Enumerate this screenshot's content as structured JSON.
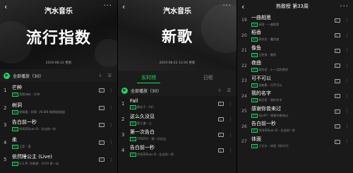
{
  "panel1": {
    "brand": "汽水音乐",
    "big_title": "流行指数",
    "date": "2019-08-22 更新",
    "play_all": "全部播放（30）",
    "songs": [
      {
        "num": "1",
        "title": "芒种",
        "sub": "音阙诗听 - 芒种"
      },
      {
        "num": "2",
        "title": "树洞",
        "sub": "林宥嘉 - 树洞（ALIEN 电视剧插曲）"
      },
      {
        "num": "3",
        "title": "告白前一秒",
        "sub": "余雨芮Ryan.B - 告白前一秒"
      },
      {
        "num": "4",
        "title": "柔",
        "sub": "王菲 - 柔"
      },
      {
        "num": "5",
        "title": "依然睡公主 (Live)",
        "sub": "G.E.M. 邓紫棋 - 2019 第一站"
      }
    ]
  },
  "panel2": {
    "brand": "汽水音乐",
    "big_title": "新歌",
    "date": "2019-08-22 12:00 更新",
    "tabs": [
      "实时榜",
      "日榜"
    ],
    "play_all": "全部播放（30）",
    "songs": [
      {
        "num": "1",
        "title": "Fall",
        "sub": "赖佳千 - Fall"
      },
      {
        "num": "2",
        "title": "这么久没见",
        "sub": "薛之谦 - 尘"
      },
      {
        "num": "3",
        "title": "第一次告白",
        "sub": "TFBOYS - 第一次告白"
      },
      {
        "num": "4",
        "title": "告白前一秒",
        "sub": "余雨芮Ryan.B - 告白前一秒"
      }
    ]
  },
  "panel3": {
    "title": "热歌榜 第33周",
    "songs": [
      {
        "num": "19",
        "title": "一曲相思",
        "sub": "半阳 - 一曲相思"
      },
      {
        "num": "20",
        "title": "稻香",
        "sub": "周杰伦 - 魔杰座"
      },
      {
        "num": "21",
        "title": "像鱼",
        "sub": "王贰浪 - 像鱼"
      },
      {
        "num": "22",
        "title": "夜曲",
        "sub": "周杰伦 - 十一月的萧邦"
      },
      {
        "num": "23",
        "title": "可不可以",
        "sub": "张紫豪 - 可不可以"
      },
      {
        "num": "24",
        "title": "我的名字",
        "sub": "焦迈奇 - 我的名字"
      },
      {
        "num": "25",
        "title": "感谢你曾来过",
        "sub": "Ayo97 - 感谢你曾来过"
      },
      {
        "num": "26",
        "title": "告白前一秒",
        "sub": "余雨芮Ryan.B - 告白前一秒"
      },
      {
        "num": "27",
        "title": "体面",
        "sub": "于文文 - 体面《前任3》"
      }
    ]
  },
  "icons": {
    "back": "‹",
    "more": "···",
    "play": "▶",
    "video": "▷",
    "row_more": "⋮"
  },
  "tag_text": "SQ",
  "colors": {
    "accent": "#1ed760",
    "background": "#181818"
  }
}
